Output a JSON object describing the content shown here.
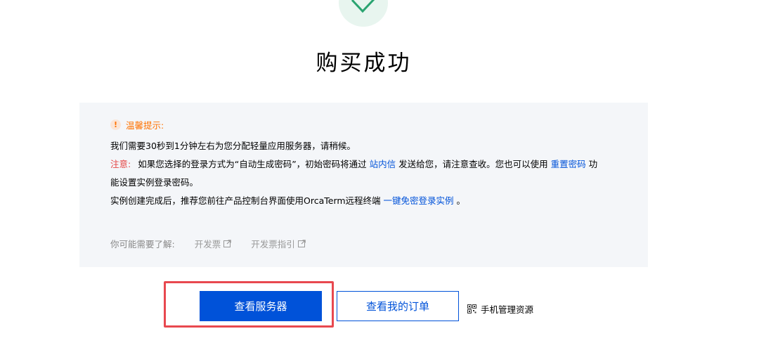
{
  "success": {
    "icon": "checkmark-icon",
    "title": "购买成功"
  },
  "notice": {
    "tip_icon": "exclamation-icon",
    "tip_title": "温馨提示:",
    "line1": "我们需要30秒到1分钟左右为您分配轻量应用服务器，请稍候。",
    "note_label": "注意:",
    "line2_a": "如果您选择的登录方式为“自动生成密码”，初始密码将通过 ",
    "line2_link1": "站内信",
    "line2_b": " 发送给您，请注意查收。您也可以使用 ",
    "line2_link2": "重置密码",
    "line2_c": " 功",
    "line3": "能设置实例登录密码。",
    "line4_a": "实例创建完成后，推荐您前往产品控制台界面使用OrcaTerm远程终端 ",
    "line4_link": "一键免密登录实例",
    "line4_b": " 。",
    "learn_label": "你可能需要了解:",
    "learn_links": [
      "开发票",
      "开发票指引"
    ]
  },
  "actions": {
    "view_server": "查看服务器",
    "view_orders": "查看我的订单",
    "mobile_manage": "手机管理资源",
    "mobile_icon": "qr-code-icon"
  },
  "colors": {
    "primary": "#0052d9",
    "warning": "#ff7200",
    "alert": "#e54545",
    "success_bg": "#e8f5ef",
    "success_check": "#2ba471",
    "highlight_border": "#e8484f"
  }
}
